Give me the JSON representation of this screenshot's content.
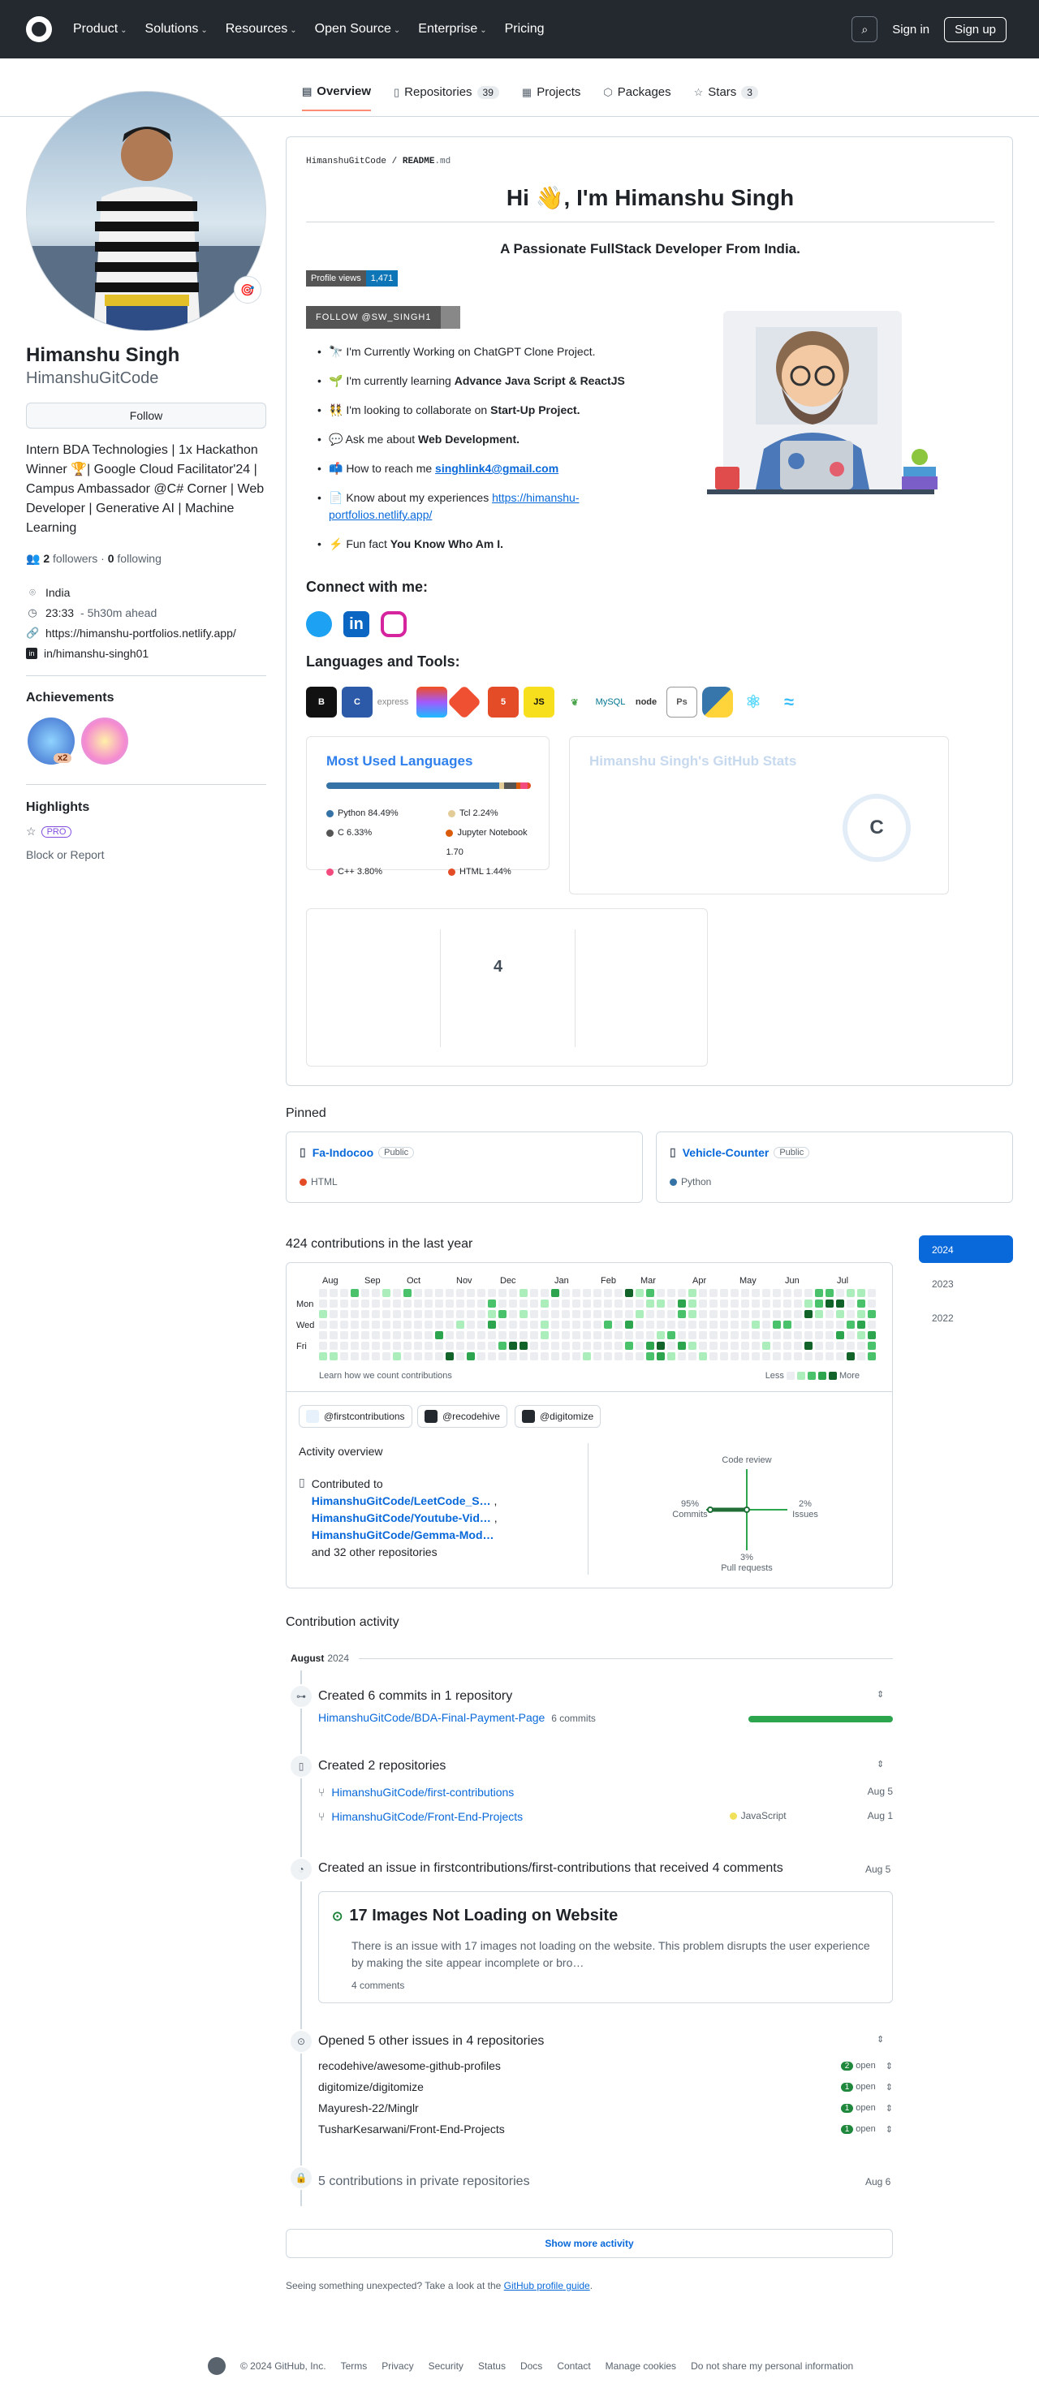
{
  "header": {
    "nav": [
      "Product",
      "Solutions",
      "Resources",
      "Open Source",
      "Enterprise",
      "Pricing"
    ],
    "sign_in": "Sign in",
    "sign_up": "Sign up"
  },
  "tabs": [
    {
      "label": "Overview",
      "icon": "book-icon"
    },
    {
      "label": "Repositories",
      "icon": "repo-icon",
      "count": "39"
    },
    {
      "label": "Projects",
      "icon": "table-icon"
    },
    {
      "label": "Packages",
      "icon": "package-icon"
    },
    {
      "label": "Stars",
      "icon": "star-icon",
      "count": "3"
    }
  ],
  "profile": {
    "name": "Himanshu Singh",
    "login": "HimanshuGitCode",
    "follow": "Follow",
    "bio": "Intern BDA Technologies | 1x Hackathon Winner 🏆| Google Cloud Facilitator'24 | Campus Ambassador @C# Corner | Web Developer | Generative AI | Machine Learning",
    "followers": "2",
    "followers_label": "followers",
    "following": "0",
    "following_label": "following",
    "location": "India",
    "time": "23:33",
    "time_note": "- 5h30m ahead",
    "website": "https://himanshu-portfolios.netlify.app/",
    "linkedin": "in/himanshu-singh01",
    "achievements_title": "Achievements",
    "achievement_count": "x2",
    "highlights_title": "Highlights",
    "pro": "PRO",
    "block": "Block or Report"
  },
  "readme": {
    "path_user": "HimanshuGitCode",
    "path_file": "README",
    "path_ext": ".md",
    "title": "Hi 👋, I'm Himanshu Singh",
    "subtitle": "A Passionate FullStack Developer From India.",
    "views_label": "Profile views",
    "views_value": "1,471",
    "follow_badge": "FOLLOW @SW_SINGH1",
    "bullets": [
      {
        "pre": "🔭 I'm Currently Working on ChatGPT Clone Project.",
        "bold": "",
        "post": ""
      },
      {
        "pre": "🌱 I'm currently learning ",
        "bold": "Advance Java Script & ReactJS",
        "post": ""
      },
      {
        "pre": "👯 I'm looking to collaborate on ",
        "bold": "Start-Up Project.",
        "post": ""
      },
      {
        "pre": "💬 Ask me about ",
        "bold": "Web Development.",
        "post": ""
      },
      {
        "pre": "📫 How to reach me ",
        "link": "singhlink4@gmail.com",
        "post": ""
      },
      {
        "pre": "📄 Know about my experiences ",
        "link2": "https://himanshu-portfolios.netlify.app/",
        "post": ""
      },
      {
        "pre": "⚡ Fun fact ",
        "bold": "You Know Who Am I.",
        "post": ""
      }
    ],
    "connect_title": "Connect with me:",
    "tools_title": "Languages and Tools:",
    "tools": [
      "Bootstrap",
      "C",
      "express",
      "Figma",
      "Git",
      "HTML",
      "JS",
      "mongoDB",
      "MySQL",
      "node",
      "Ps",
      "Python",
      "React",
      "Tailwind"
    ],
    "langs_title": "Most Used Languages",
    "langs": [
      {
        "name": "Python",
        "pct": "84.49%",
        "value": 84.49,
        "color": "#3572A5"
      },
      {
        "name": "Tcl",
        "pct": "2.24%",
        "value": 2.24,
        "color": "#e4cc98"
      },
      {
        "name": "C",
        "pct": "6.33%",
        "value": 6.33,
        "color": "#555555"
      },
      {
        "name": "Jupyter Notebook",
        "pct": "1.70",
        "value": 1.7,
        "color": "#DA5B0B"
      },
      {
        "name": "C++",
        "pct": "3.80%",
        "value": 3.8,
        "color": "#f34b7d"
      },
      {
        "name": "HTML",
        "pct": "1.44%",
        "value": 1.44,
        "color": "#e34c26"
      }
    ],
    "stats_title": "Himanshu Singh's GitHub Stats",
    "grade": "C",
    "streak_value": "4"
  },
  "pinned": {
    "title": "Pinned",
    "repos": [
      {
        "name": "Fa-Indocoo",
        "visibility": "Public",
        "lang": "HTML",
        "color": "#e34c26"
      },
      {
        "name": "Vehicle-Counter",
        "visibility": "Public",
        "lang": "Python",
        "color": "#3572A5"
      }
    ]
  },
  "contrib": {
    "title": "424 contributions in the last year",
    "months": [
      "Aug",
      "Sep",
      "Oct",
      "Nov",
      "Dec",
      "Jan",
      "Feb",
      "Mar",
      "Apr",
      "May",
      "Jun",
      "Jul"
    ],
    "days": [
      "Mon",
      "Wed",
      "Fri"
    ],
    "learn": "Learn how we count contributions",
    "less": "Less",
    "more": "More",
    "years": [
      "2024",
      "2023",
      "2022"
    ],
    "orgs": [
      "@firstcontributions",
      "@recodehive",
      "@digitomize"
    ],
    "overview_title": "Activity overview",
    "contributed_to": "Contributed to",
    "repos": [
      "HimanshuGitCode/LeetCode_S…",
      "HimanshuGitCode/Youtube-Vid…",
      "HimanshuGitCode/Gemma-Mod…"
    ],
    "other": "and 32 other repositories",
    "axes": {
      "code_review": "Code review",
      "commits_pct": "95%",
      "commits": "Commits",
      "issues_pct": "2%",
      "issues": "Issues",
      "pr_pct": "3%",
      "pr": "Pull requests"
    }
  },
  "activity": {
    "title": "Contribution activity",
    "month": "August",
    "year": "2024",
    "commits_title": "Created 6 commits in 1 repository",
    "commit_repo": "HimanshuGitCode/BDA-Final-Payment-Page",
    "commit_count": "6 commits",
    "repos_title": "Created 2 repositories",
    "created": [
      {
        "name": "HimanshuGitCode/first-contributions",
        "lang": "",
        "date": "Aug 5"
      },
      {
        "name": "HimanshuGitCode/Front-End-Projects",
        "lang": "JavaScript",
        "date": "Aug 1"
      }
    ],
    "issue_title": "Created an issue in firstcontributions/first-contributions that received 4 comments",
    "issue_date": "Aug 5",
    "issue_name": "17 Images Not Loading on Website",
    "issue_body": "There is an issue with 17 images not loading on the website. This problem disrupts the user experience by making the site appear incomplete or bro…",
    "issue_comments": "4 comments",
    "opened_title": "Opened 5 other issues in 4 repositories",
    "opened": [
      {
        "repo": "recodehive/awesome-github-profiles",
        "n": "2",
        "label": "open"
      },
      {
        "repo": "digitomize/digitomize",
        "n": "1",
        "label": "open"
      },
      {
        "repo": "Mayuresh-22/Minglr",
        "n": "1",
        "label": "open"
      },
      {
        "repo": "TusharKesarwani/Front-End-Projects",
        "n": "1",
        "label": "open"
      }
    ],
    "private_title": "5 contributions in private repositories",
    "private_date": "Aug 6",
    "show_more": "Show more activity",
    "unexpected": "Seeing something unexpected? Take a look at the",
    "guide": "GitHub profile guide",
    "period": "."
  },
  "footer": {
    "copyright": "© 2024 GitHub, Inc.",
    "links": [
      "Terms",
      "Privacy",
      "Security",
      "Status",
      "Docs",
      "Contact",
      "Manage cookies",
      "Do not share my personal information"
    ]
  }
}
